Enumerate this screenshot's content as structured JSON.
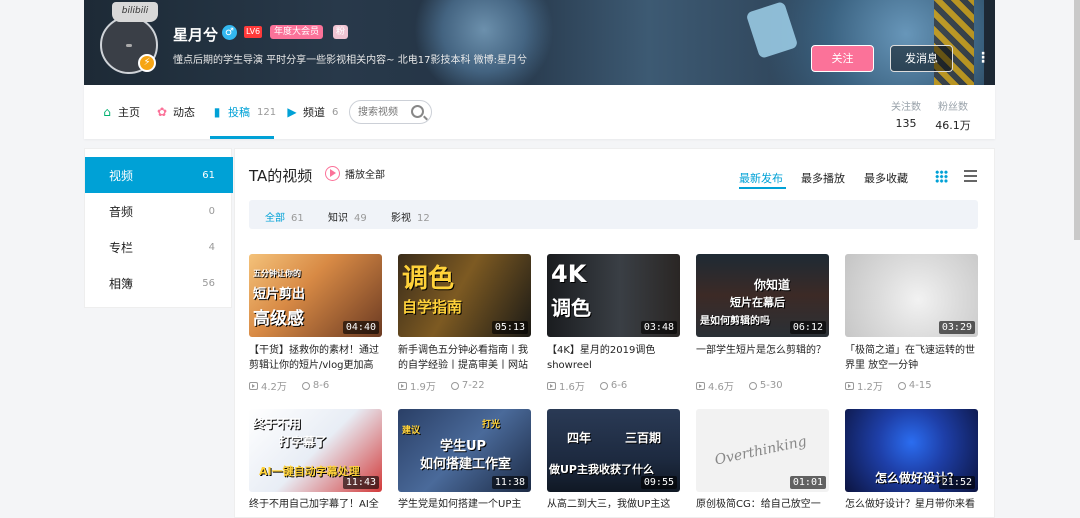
{
  "profile": {
    "avatar_text": "bilibili",
    "name": "星月兮",
    "level": "LV6",
    "vip": "年度大会员",
    "medal": "粉",
    "signature": "懂点后期的学生导演 平时分享一些影视相关内容~ 北电17影技本科 微博:星月兮",
    "follow_label": "关注",
    "message_label": "发消息",
    "more_icon": "⋮"
  },
  "nav": {
    "tabs": [
      {
        "label": "主页",
        "icon": "home-icon",
        "glyph": "⌂",
        "count": "",
        "color": "#00b06f"
      },
      {
        "label": "动态",
        "icon": "dynamic-icon",
        "glyph": "✿",
        "count": "",
        "color": "#fb7299"
      },
      {
        "label": "投稿",
        "icon": "upload-icon",
        "glyph": "▮",
        "count": "121",
        "color": "#00a1d6"
      },
      {
        "label": "频道",
        "icon": "channel-icon",
        "glyph": "▶",
        "count": "6",
        "color": "#00a1d6"
      }
    ],
    "search_placeholder": "搜索视频",
    "stats": [
      {
        "label": "关注数",
        "value": "135"
      },
      {
        "label": "粉丝数",
        "value": "46.1万"
      }
    ]
  },
  "sidebar": {
    "items": [
      {
        "label": "视频",
        "count": "61"
      },
      {
        "label": "音频",
        "count": "0"
      },
      {
        "label": "专栏",
        "count": "4"
      },
      {
        "label": "相簿",
        "count": "56"
      }
    ]
  },
  "main": {
    "title": "TA的视频",
    "play_all": "播放全部",
    "sorts": [
      "最新发布",
      "最多播放",
      "最多收藏"
    ],
    "filters": [
      {
        "label": "全部",
        "count": "61"
      },
      {
        "label": "知识",
        "count": "49"
      },
      {
        "label": "影视",
        "count": "12"
      }
    ]
  },
  "videos": [
    {
      "thumb_text": [
        "五分钟让你的",
        "短片剪出",
        "高级感"
      ],
      "duration": "04:40",
      "title": "【干货】拯救你的素材！通过剪辑让你的短片/vlog更加高",
      "plays": "4.2万",
      "date": "8-6"
    },
    {
      "thumb_text": [
        "调色",
        "自学指南"
      ],
      "duration": "05:13",
      "title": "新手调色五分钟必看指南丨我的自学经验丨提高审美丨网站",
      "plays": "1.9万",
      "date": "7-22"
    },
    {
      "thumb_text": [
        "4K",
        "调色"
      ],
      "duration": "03:48",
      "title": "【4K】星月的2019调色showreel",
      "plays": "1.6万",
      "date": "6-6"
    },
    {
      "thumb_text": [
        "你知道",
        "短片在幕后",
        "是如何剪辑的吗"
      ],
      "duration": "06:12",
      "title": "一部学生短片是怎么剪辑的？",
      "plays": "4.6万",
      "date": "5-30"
    },
    {
      "thumb_text": [],
      "duration": "03:29",
      "title": "「极简之道」在飞速运转的世界里 放空一分钟",
      "plays": "1.2万",
      "date": "4-15"
    },
    {
      "thumb_text": [
        "终于不用",
        "打字幕了",
        "AI一键自动字幕处理"
      ],
      "duration": "11:43",
      "title": "终于不用自己加字幕了！AI全",
      "plays": "",
      "date": ""
    },
    {
      "thumb_text": [
        "建议",
        "打光",
        "学生UP",
        "如何搭建工作室"
      ],
      "duration": "11:38",
      "title": "学生党是如何搭建一个UP主",
      "plays": "",
      "date": ""
    },
    {
      "thumb_text": [
        "四年",
        "三百期",
        "做UP主我收获了什么"
      ],
      "duration": "09:55",
      "title": "从高二到大三，我做UP主这",
      "plays": "",
      "date": ""
    },
    {
      "thumb_text": [
        "Overthinking"
      ],
      "duration": "01:01",
      "title": "原创极简CG：给自己放空一",
      "plays": "",
      "date": ""
    },
    {
      "thumb_text": [
        "怎么做好设计？"
      ],
      "duration": "21:52",
      "title": "怎么做好设计？星月带你来看",
      "plays": "",
      "date": ""
    }
  ]
}
